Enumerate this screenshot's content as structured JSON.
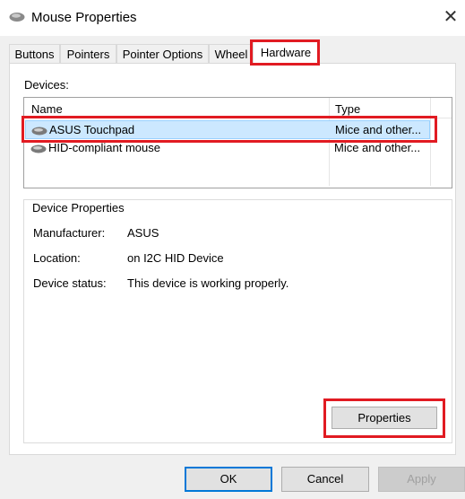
{
  "window": {
    "title": "Mouse Properties",
    "close_glyph": "✕"
  },
  "tabs": [
    {
      "label": "Buttons"
    },
    {
      "label": "Pointers"
    },
    {
      "label": "Pointer Options"
    },
    {
      "label": "Wheel"
    },
    {
      "label": "Hardware",
      "active": true
    }
  ],
  "devices": {
    "label": "Devices:",
    "columns": {
      "name": "Name",
      "type": "Type"
    },
    "rows": [
      {
        "name": "ASUS Touchpad",
        "type": "Mice and other...",
        "selected": true,
        "icon": "mouse-icon"
      },
      {
        "name": "HID-compliant mouse",
        "type": "Mice and other...",
        "selected": false,
        "icon": "mouse-icon"
      }
    ]
  },
  "device_properties": {
    "title": "Device Properties",
    "manufacturer_label": "Manufacturer:",
    "manufacturer": "ASUS",
    "location_label": "Location:",
    "location": "on I2C HID Device",
    "status_label": "Device status:",
    "status": "This device is working properly.",
    "properties_button": "Properties"
  },
  "footer": {
    "ok": "OK",
    "cancel": "Cancel",
    "apply": "Apply"
  },
  "colors": {
    "highlight": "#e11b22",
    "selection": "#cce8ff",
    "focus": "#0078d7"
  }
}
